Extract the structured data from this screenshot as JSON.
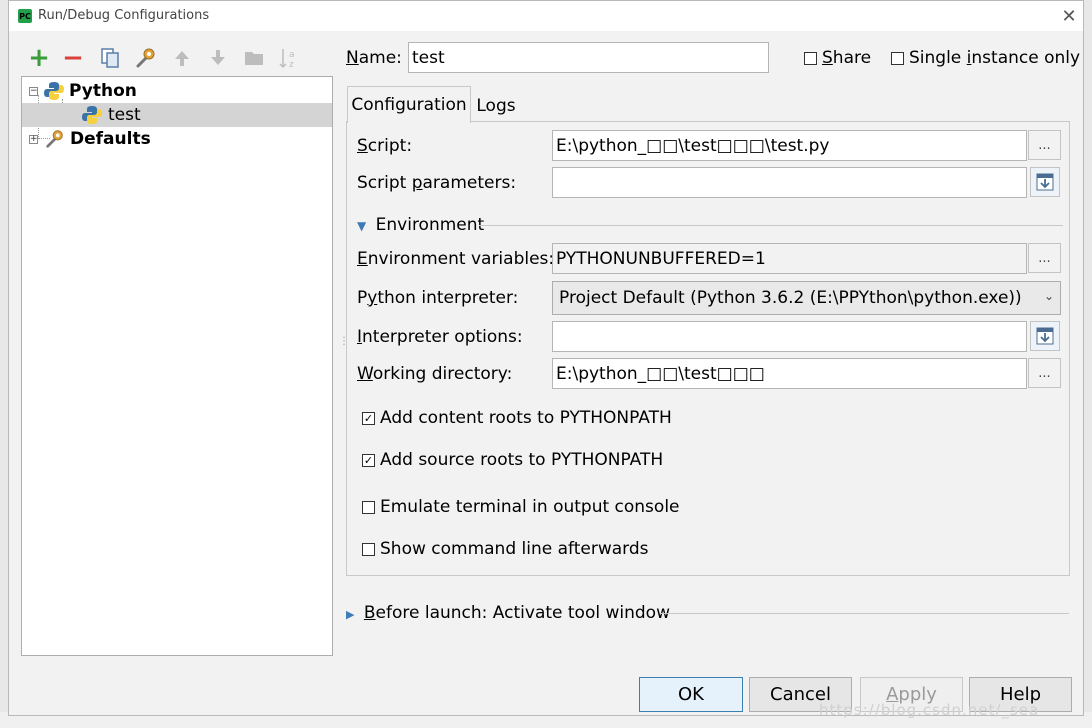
{
  "window": {
    "title": "Run/Debug Configurations",
    "close_glyph": "✕"
  },
  "toolbar": {
    "add_icon": "plus-icon",
    "remove_icon": "minus-icon",
    "copy_icon": "copy-icon",
    "edit_defaults_icon": "wrench-icon",
    "move_up_icon": "arrow-up-icon",
    "move_down_icon": "arrow-down-icon",
    "folder_icon": "folder-icon",
    "sort_icon": "sort-az-icon"
  },
  "tree": {
    "python_label": "Python",
    "test_label": "test",
    "defaults_label": "Defaults"
  },
  "form": {
    "name_label_u": "N",
    "name_label_rest": "ame:",
    "name_value": "test",
    "share_label_pre": "",
    "share_label_u": "S",
    "share_label_rest": "hare",
    "single_instance_pre": "Single ",
    "single_instance_u": "i",
    "single_instance_rest": "nstance only"
  },
  "tabs": {
    "configuration": "Configuration",
    "logs": "Logs"
  },
  "config": {
    "script_label_u": "S",
    "script_label_rest": "cript:",
    "script_value": "E:\\python_□□\\test□□□\\test.py",
    "script_params_label_pre": "Script ",
    "script_params_label_u": "p",
    "script_params_label_rest": "arameters:",
    "script_params_value": "",
    "environment_header": "Environment",
    "env_vars_label_u": "E",
    "env_vars_label_rest": "nvironment variables:",
    "env_vars_value": "PYTHONUNBUFFERED=1",
    "interpreter_label_pre": "P",
    "interpreter_label_u": "y",
    "interpreter_label_rest": "thon interpreter:",
    "interpreter_value": "Project Default (Python 3.6.2 (E:\\PPYthon\\python.exe))",
    "interp_options_label_u": "I",
    "interp_options_label_rest": "nterpreter options:",
    "interp_options_value": "",
    "working_dir_label_u": "W",
    "working_dir_label_rest": "orking directory:",
    "working_dir_value": "E:\\python_□□\\test□□□",
    "add_content_roots": "Add content roots to PYTHONPATH",
    "add_content_roots_checked": true,
    "add_source_roots": "Add source roots to PYTHONPATH",
    "add_source_roots_checked": true,
    "emulate_terminal": "Emulate terminal in output console",
    "emulate_terminal_checked": false,
    "show_command_line": "Show command line afterwards",
    "show_command_line_checked": false,
    "dots_glyph": "..."
  },
  "before_launch": {
    "label_u": "B",
    "label_rest": "efore launch: Activate tool window"
  },
  "buttons": {
    "ok": "OK",
    "cancel": "Cancel",
    "apply_u": "A",
    "apply_rest": "pply",
    "help": "Help"
  },
  "watermark": "https://blog.csdn.net/_sea",
  "colors": {
    "accent": "#3c7fb1",
    "add_green": "#3b9c3b",
    "remove_red": "#d9413b",
    "selection": "#d4d4d4"
  }
}
